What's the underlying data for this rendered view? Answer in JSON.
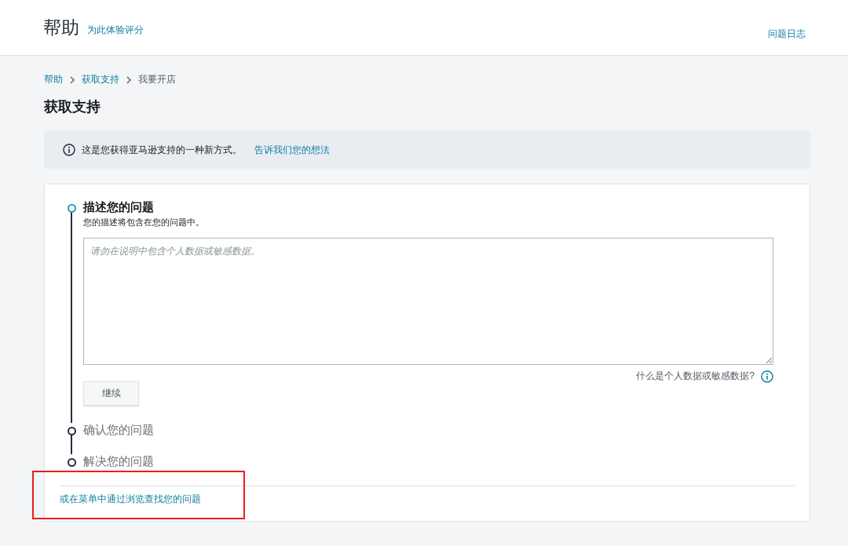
{
  "header": {
    "title": "帮助",
    "rate_link": "为此体验评分",
    "case_log_link": "问题日志"
  },
  "breadcrumb": [
    {
      "label": "帮助",
      "kind": "link"
    },
    {
      "label": "获取支持",
      "kind": "link"
    },
    {
      "label": "我要开店",
      "kind": "current"
    }
  ],
  "page_title": "获取支持",
  "info_banner": {
    "text": "这是您获得亚马逊支持的一种新方式。",
    "link": "告诉我们您的想法"
  },
  "steps": [
    {
      "title": "描述您的问题",
      "active": true,
      "subtitle": "您的描述将包含在您的问题中。",
      "placeholder": "请勿在说明中包含个人数据或敏感数据。",
      "help_link": "什么是个人数据或敏感数据?",
      "button": "继续"
    },
    {
      "title": "确认您的问题",
      "active": false
    },
    {
      "title": "解决您的问题",
      "active": false
    }
  ],
  "browse_link": "或在菜单中通过浏览查找您的问题"
}
